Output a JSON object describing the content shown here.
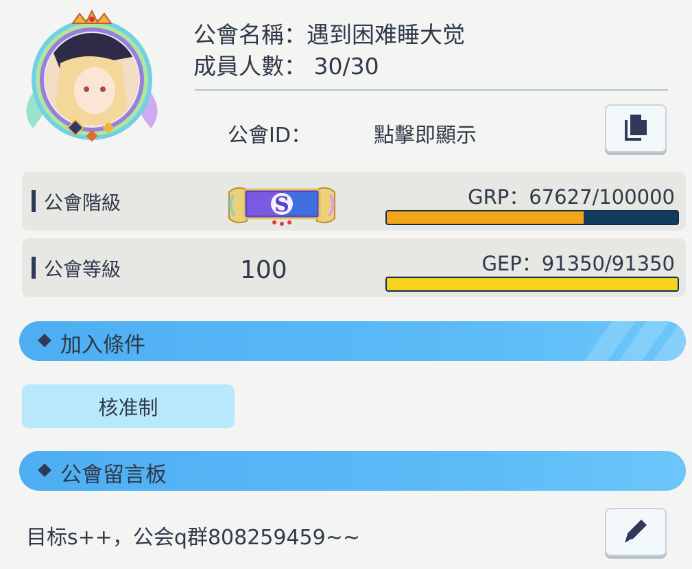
{
  "guild": {
    "name_line": "公會名稱：遇到困难睡大觉",
    "members_line": "成員人數： 30/30",
    "id_label": "公會ID：",
    "id_value": "點擊即顯示"
  },
  "stats": {
    "rank": {
      "label": "公會階級",
      "badge_letter": "S",
      "value_text": "GRP：67627/100000",
      "progress": 0.676,
      "bar_color": "#f4a417"
    },
    "level": {
      "label": "公會等級",
      "level": "100",
      "value_text": "GEP：91350/91350",
      "progress": 1.0,
      "bar_color": "#f7d31d"
    }
  },
  "sections": {
    "join_conditions": {
      "title": "加入條件",
      "value": "核准制"
    },
    "board": {
      "title": "公會留言板",
      "message": "目标s++，公会q群808259459~~"
    }
  },
  "icons": {
    "copy": "copy-icon",
    "edit": "pencil-icon",
    "section_marker": "diamond-icon"
  },
  "colors": {
    "accent_blue": "#4eaef3",
    "grp_bar": "#f4a417",
    "gep_bar": "#f7d31d",
    "bar_track": "#123b5c"
  }
}
